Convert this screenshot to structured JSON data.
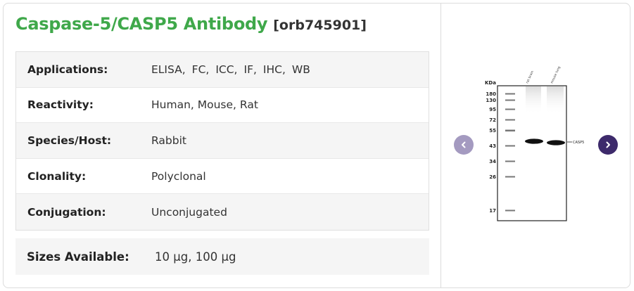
{
  "product": {
    "title": "Caspase-5/CASP5 Antibody",
    "sku": "[orb745901]"
  },
  "specs": [
    {
      "label": "Applications:",
      "value": "ELISA, FC, ICC, IF, IHC, WB"
    },
    {
      "label": "Reactivity:",
      "value": "Human, Mouse, Rat"
    },
    {
      "label": "Species/Host:",
      "value": "Rabbit"
    },
    {
      "label": "Clonality:",
      "value": "Polyclonal"
    },
    {
      "label": "Conjugation:",
      "value": "Unconjugated"
    }
  ],
  "applications": [
    "ELISA,",
    "FC,",
    "ICC,",
    "IF,",
    "IHC,",
    "WB"
  ],
  "sizes": {
    "label": "Sizes Available:",
    "value": "10 µg, 100 µg"
  },
  "blot": {
    "unit_label": "KDa",
    "markers": [
      "180",
      "130",
      "95",
      "72",
      "55",
      "43",
      "34",
      "26",
      "17"
    ],
    "lanes": [
      "rat brain",
      "mouse lung"
    ],
    "band_label": "CASP5"
  },
  "carousel": {
    "prev_icon": "chevron-left-icon",
    "next_icon": "chevron-right-icon"
  },
  "colors": {
    "title": "#3fa84a",
    "prev_button": "#a49ac0",
    "next_button": "#3d2a6b"
  }
}
